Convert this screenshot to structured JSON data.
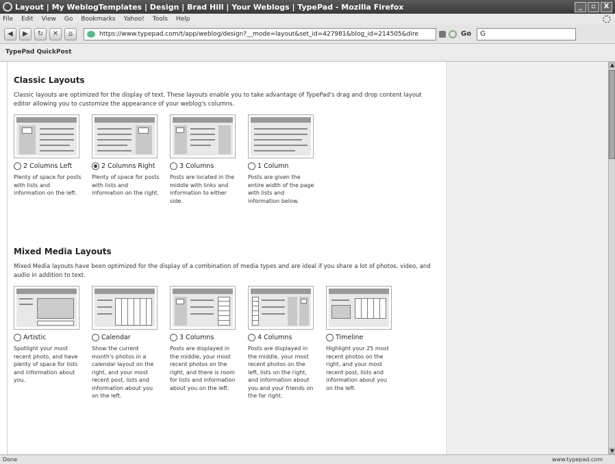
{
  "window": {
    "title": "Layout | My WeblogTemplates | Design | Brad Hill | Your Weblogs | TypePad - Mozilla Firefox",
    "buttons": [
      "_",
      "▫",
      "X"
    ]
  },
  "menu": [
    "File",
    "Edit",
    "View",
    "Go",
    "Bookmarks",
    "Yahoo!",
    "Tools",
    "Help"
  ],
  "nav": {
    "url": "https://www.typepad.com/t/app/weblog/design?__mode=layout&set_id=427981&blog_id=214505&dire",
    "go_label": "Go",
    "search_value": "G"
  },
  "bookmarks": {
    "item": "TypePad QuickPost"
  },
  "classic": {
    "heading": "Classic Layouts",
    "description": "Classic layouts are optimized for the display of text. These layouts enable you to take advantage of TypePad's drag and drop content layout editor allowing you to customize the appearance of your weblog's columns.",
    "options": [
      {
        "label": "2 Columns Left",
        "selected": false,
        "desc": "Plenty of space for posts with lists and information on the left."
      },
      {
        "label": "2 Columns Right",
        "selected": true,
        "desc": "Plenty of space for posts with lists and information on the right."
      },
      {
        "label": "3 Columns",
        "selected": false,
        "desc": "Posts are located in the middle with links and information to either side."
      },
      {
        "label": "1 Column",
        "selected": false,
        "desc": "Posts are given the entire width of the page with lists and information below."
      }
    ]
  },
  "mixed": {
    "heading": "Mixed Media Layouts",
    "description": "Mixed Media layouts have been optimized for the display of a combination of media types and are ideal if you share a lot of photos, video, and audio in addition to text.",
    "options": [
      {
        "label": "Artistic",
        "selected": false,
        "desc": "Spotlight your most recent photo, and have plenty of space for lists and information about you."
      },
      {
        "label": "Calendar",
        "selected": false,
        "desc": "Show the current month's photos in a calendar layout on the right, and your most recent post, lists and information about you on the left."
      },
      {
        "label": "3 Columns",
        "selected": false,
        "desc": "Posts are displayed in the middle, your most recent photos on the right, and there is room for lists and information about you on the left."
      },
      {
        "label": "4 Columns",
        "selected": false,
        "desc": "Posts are displayed in the middle, your most recent photos on the left, lists on the right, and information about you and your friends on the far right."
      },
      {
        "label": "Timeline",
        "selected": false,
        "desc": "Highlight your 25 most recent photos on the right, and your most recent post, lists and information about you on the left."
      }
    ]
  },
  "status": {
    "left": "Done",
    "right": "www.typepad.com"
  }
}
